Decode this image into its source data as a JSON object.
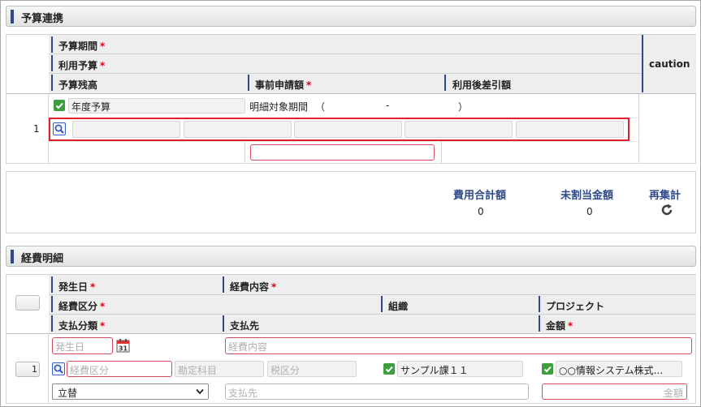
{
  "budget_section": {
    "title": "予算連携",
    "headers": {
      "period": "予算期間",
      "budget": "利用予算",
      "balance": "予算残高",
      "application_amount": "事前申請額",
      "after_deduction": "利用後差引額",
      "caution": "caution",
      "required_mark": "*"
    },
    "row": {
      "number": "1",
      "budget_type_label": "年度予算",
      "period_label": "明細対象期間",
      "period_open": "（",
      "period_sep": "-",
      "period_close": "）"
    },
    "totals": {
      "expense_total_label": "費用合計額",
      "expense_total_value": "0",
      "unallocated_label": "未割当金額",
      "unallocated_value": "0",
      "recalc_label": "再集計"
    }
  },
  "expense_section": {
    "title": "経費明細",
    "headers": {
      "date": "発生日",
      "content": "経費内容",
      "category": "経費区分",
      "organization": "組織",
      "project": "プロジェクト",
      "payment_type": "支払分類",
      "payee": "支払先",
      "amount": "金額",
      "required_mark": "*"
    },
    "row": {
      "number": "1",
      "date_placeholder": "発生日",
      "calendar_day": "31",
      "content_placeholder": "経費内容",
      "category_placeholder": "経費区分",
      "account_placeholder": "勘定科目",
      "tax_placeholder": "税区分",
      "organization_value": "サンプル課１１",
      "project_value": "○○情報システム株式...",
      "payment_type_value": "立替",
      "payee_placeholder": "支払先",
      "amount_placeholder": "金額"
    }
  },
  "colors": {
    "accent": "#2f4a8a",
    "required": "#d9001b",
    "highlight": "#e0202a",
    "check": "#3c9e3c"
  }
}
